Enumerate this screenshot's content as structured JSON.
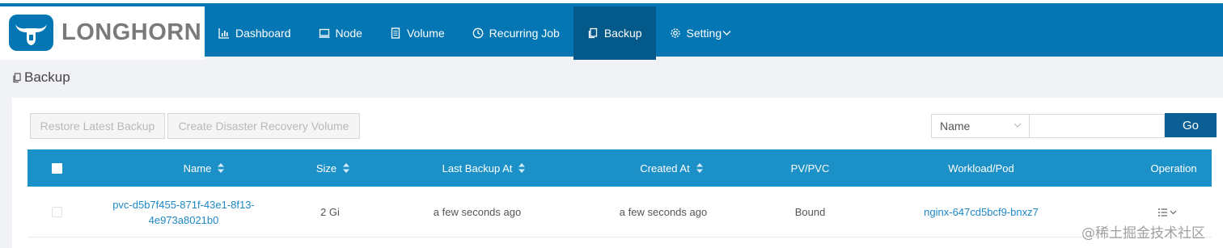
{
  "app": {
    "logo_text": "LONGHORN"
  },
  "nav": {
    "items": [
      {
        "label": "Dashboard",
        "icon": "chart-icon"
      },
      {
        "label": "Node",
        "icon": "monitor-icon"
      },
      {
        "label": "Volume",
        "icon": "list-icon"
      },
      {
        "label": "Recurring Job",
        "icon": "clock-icon"
      },
      {
        "label": "Backup",
        "icon": "copy-icon",
        "active": true
      },
      {
        "label": "Setting",
        "icon": "gear-icon",
        "has_dropdown": true
      }
    ]
  },
  "page": {
    "title": "Backup"
  },
  "toolbar": {
    "restore_label": "Restore Latest Backup",
    "dr_label": "Create Disaster Recovery Volume",
    "filter_select_value": "Name",
    "search_value": "",
    "go_label": "Go"
  },
  "table": {
    "columns": [
      {
        "label": "Name",
        "sortable": true
      },
      {
        "label": "Size",
        "sortable": true
      },
      {
        "label": "Last Backup At",
        "sortable": true
      },
      {
        "label": "Created At",
        "sortable": true
      },
      {
        "label": "PV/PVC",
        "sortable": false
      },
      {
        "label": "Workload/Pod",
        "sortable": false
      },
      {
        "label": "Operation",
        "sortable": false
      }
    ],
    "rows": [
      {
        "name_line1": "pvc-d5b7f455-871f-43e1-8f13-",
        "name_line2": "4e973a8021b0",
        "size": "2 Gi",
        "last_backup_at": "a few seconds ago",
        "created_at": "a few seconds ago",
        "pv_pvc": "Bound",
        "workload_pod": "nginx-647cd5bcf9-bnxz7"
      }
    ]
  },
  "watermark": "@稀土掘金技术社区",
  "colors": {
    "header": "#0376b3",
    "nav_active": "#035a8a",
    "table_header": "#1c91c8",
    "go_button": "#0b5f94",
    "link": "#1e88c7"
  }
}
